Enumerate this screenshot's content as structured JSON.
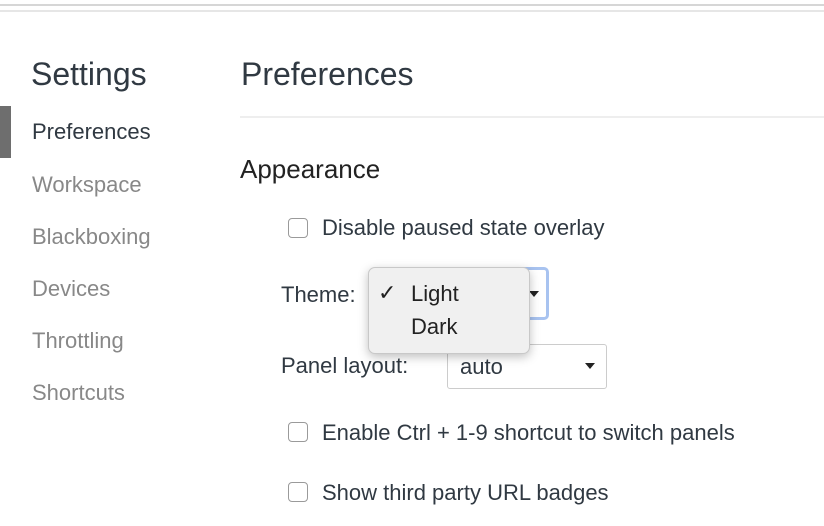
{
  "sidebar": {
    "title": "Settings",
    "items": [
      {
        "label": "Preferences",
        "active": true
      },
      {
        "label": "Workspace"
      },
      {
        "label": "Blackboxing"
      },
      {
        "label": "Devices"
      },
      {
        "label": "Throttling"
      },
      {
        "label": "Shortcuts"
      }
    ]
  },
  "main": {
    "title": "Preferences",
    "section": "Appearance",
    "disable_overlay": {
      "label": "Disable paused state overlay",
      "checked": false
    },
    "theme": {
      "label": "Theme:",
      "selected": "Light",
      "options": [
        "Light",
        "Dark"
      ]
    },
    "panel_layout": {
      "label": "Panel layout:",
      "value": "auto"
    },
    "ctrl_shortcut": {
      "label": "Enable Ctrl + 1-9 shortcut to switch panels",
      "checked": false
    },
    "url_badges": {
      "label": "Show third party URL badges",
      "checked": false
    }
  },
  "colors": {
    "active_indicator": "#6e6e6e",
    "focus_ring": "#a8c3f0"
  }
}
